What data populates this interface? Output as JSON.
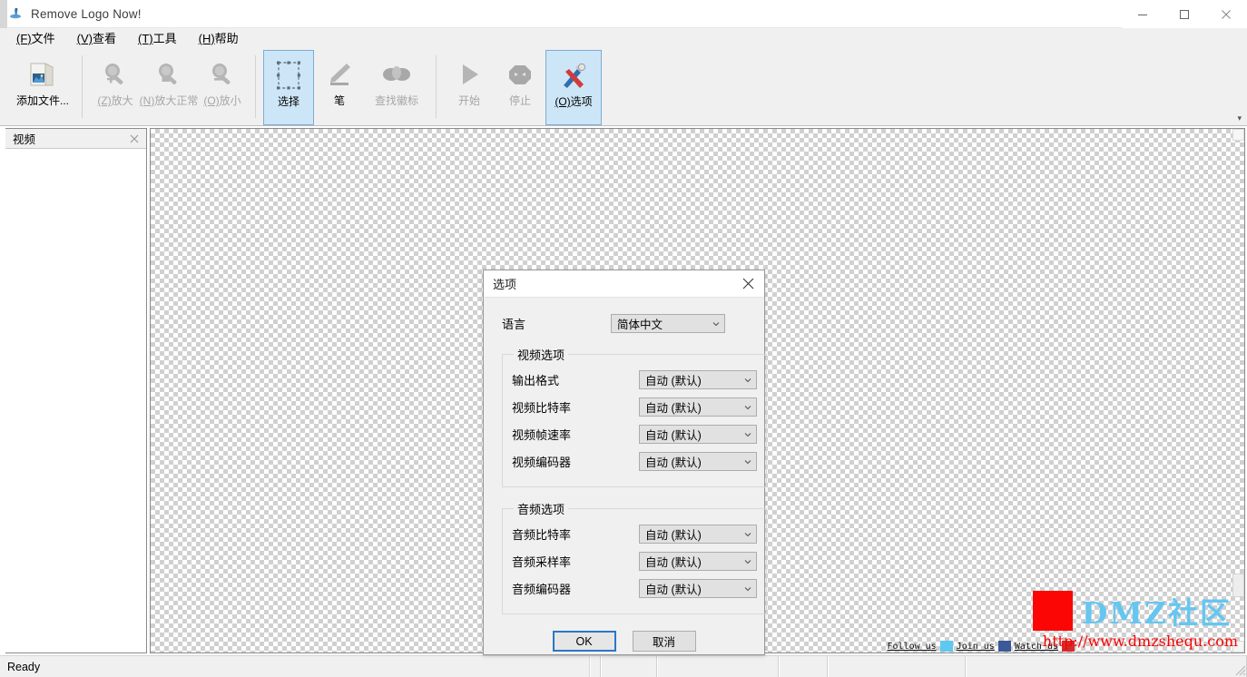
{
  "window": {
    "title": "Remove Logo Now!",
    "icon": "app-logo-icon",
    "minimize_label": "Minimize",
    "maximize_label": "Maximize",
    "close_label": "Close"
  },
  "menubar": {
    "items": [
      {
        "acc": "(F)",
        "text": "文件"
      },
      {
        "acc": "(V)",
        "text": "查看"
      },
      {
        "acc": "(T)",
        "text": "工具"
      },
      {
        "acc": "(H)",
        "text": "帮助"
      }
    ]
  },
  "toolbar": {
    "overflow_glyph": "▾",
    "items": [
      {
        "label": "添加文件...",
        "acc": "",
        "icon": "add-file-icon",
        "state": "enabled"
      },
      {
        "label": "放大",
        "acc": "(Z)",
        "icon": "zoom-in-icon",
        "state": "disabled"
      },
      {
        "label": "放大正常",
        "acc": "(N)",
        "icon": "zoom-normal-icon",
        "state": "disabled"
      },
      {
        "label": "放小",
        "acc": "(O)",
        "icon": "zoom-out-icon",
        "state": "disabled"
      },
      {
        "label": "选择",
        "acc": "",
        "icon": "selection-marquee-icon",
        "state": "active"
      },
      {
        "label": "笔",
        "acc": "",
        "icon": "pen-icon",
        "state": "disabled"
      },
      {
        "label": "查找徽标",
        "acc": "",
        "icon": "find-logo-icon",
        "state": "disabled"
      },
      {
        "label": "开始",
        "acc": "",
        "icon": "play-icon",
        "state": "disabled"
      },
      {
        "label": "停止",
        "acc": "",
        "icon": "stop-octagon-icon",
        "state": "disabled"
      },
      {
        "label": "选项",
        "acc": "(O)",
        "icon": "options-tools-icon",
        "state": "active"
      }
    ]
  },
  "sidepanel": {
    "tab_title": "视频",
    "close_icon": "close-icon"
  },
  "dialog": {
    "title": "选项",
    "close_icon": "close-icon",
    "language": {
      "label": "语言",
      "value": "简体中文"
    },
    "video_group": {
      "legend": "视频选项",
      "rows": [
        {
          "label": "输出格式",
          "value": "自动 (默认)"
        },
        {
          "label": "视频比特率",
          "value": "自动 (默认)"
        },
        {
          "label": "视频帧速率",
          "value": "自动 (默认)"
        },
        {
          "label": "视频编码器",
          "value": "自动 (默认)"
        }
      ]
    },
    "audio_group": {
      "legend": "音频选项",
      "rows": [
        {
          "label": "音频比特率",
          "value": "自动 (默认)"
        },
        {
          "label": "音频采样率",
          "value": "自动 (默认)"
        },
        {
          "label": "音频编码器",
          "value": "自动 (默认)"
        }
      ]
    },
    "ok_label": "OK",
    "cancel_label": "取消"
  },
  "statusbar": {
    "ready_text": "Ready",
    "cells": [
      "",
      "",
      "",
      "",
      "",
      ""
    ]
  },
  "watermark": {
    "brand": "DMZ社区",
    "url": "http://www.dmzshequ.com",
    "follow_us": "Follow us",
    "join_us": "Join us",
    "watch_us": "Watch us",
    "brand_color": "#66c6f0",
    "square_color": "#fb0505",
    "url_color": "#fb0000"
  }
}
